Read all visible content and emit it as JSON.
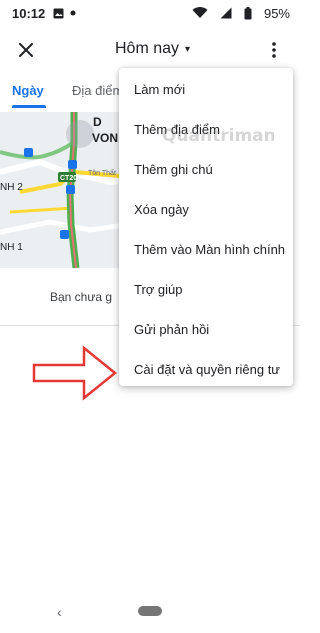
{
  "status_bar": {
    "time": "10:12",
    "battery": "95%",
    "icons": [
      "image-icon",
      "dot-icon",
      "wifi-icon",
      "signal-icon",
      "battery-icon"
    ]
  },
  "app_bar": {
    "close_icon": "close-icon",
    "title": "Hôm nay",
    "dropdown_arrow": "▾",
    "more_icon": "more-vert-icon"
  },
  "tabs": [
    {
      "label": "Ngày",
      "active": true
    },
    {
      "label": "Địa điểm",
      "active": false
    }
  ],
  "map": {
    "labels": [
      "D",
      "VON",
      "Tôn Thất",
      "NH 2",
      "NH 1",
      "CT20"
    ]
  },
  "main": {
    "empty_message": "Bạn chưa g"
  },
  "menu": {
    "items": [
      "Làm mới",
      "Thêm địa điểm",
      "Thêm ghi chú",
      "Xóa ngày",
      "Thêm vào Màn hình chính",
      "Trợ giúp",
      "Gửi phản hồi",
      "Cài đặt và quyền riêng tư"
    ]
  },
  "annotation": {
    "arrow_color": "#e53935"
  },
  "watermark_text": "Quantrimang",
  "nav_bar": {
    "back": "‹"
  },
  "colors": {
    "accent": "#1a73e8",
    "route_green": "#4caf50",
    "arrow_red": "#e53935"
  }
}
